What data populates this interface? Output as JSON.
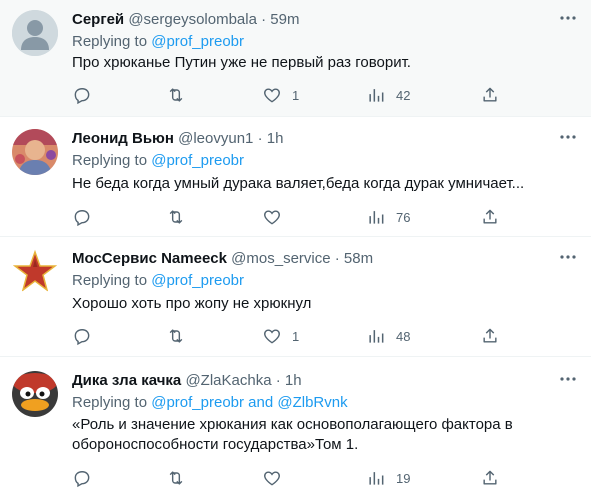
{
  "tweets": [
    {
      "name": "Сергей",
      "handle": "@sergeysolombala",
      "sep": "·",
      "time": "59m",
      "reply_prefix": "Replying to",
      "reply_to": "@prof_preobr",
      "text": "Про хрюканье Путин уже не первый раз говорит.",
      "likes": "1",
      "views": "42"
    },
    {
      "name": "Леонид Вьюн",
      "handle": "@leovyun1",
      "sep": "·",
      "time": "1h",
      "reply_prefix": "Replying to",
      "reply_to": "@prof_preobr",
      "text": "Не беда когда умный дурака валяет,беда когда дурак умничает...",
      "likes": "",
      "views": "76"
    },
    {
      "name": "МосСервис Nameeck",
      "handle": "@mos_service",
      "sep": "·",
      "time": "58m",
      "reply_prefix": "Replying to",
      "reply_to": "@prof_preobr",
      "text": "Хорошо хоть про жопу не хрюкнул",
      "likes": "1",
      "views": "48"
    },
    {
      "name": "Дика зла качка",
      "handle": "@ZlaKachka",
      "sep": "·",
      "time": "1h",
      "reply_prefix": "Replying to",
      "reply_to": "@prof_preobr and @ZlbRvnk",
      "text": "«Роль и значение хрюкания как основополагающего фактора в обороноспособности государства»Том 1.",
      "likes": "",
      "views": "19"
    }
  ],
  "icons": {
    "reply": "reply-icon",
    "retweet": "retweet-icon",
    "like": "like-icon",
    "views": "views-icon",
    "share": "share-icon",
    "more": "more-icon"
  },
  "colors": {
    "link": "#1d9bf0",
    "muted": "#536471",
    "text": "#0f1419",
    "highlight_bg": "#f7f9f9"
  }
}
